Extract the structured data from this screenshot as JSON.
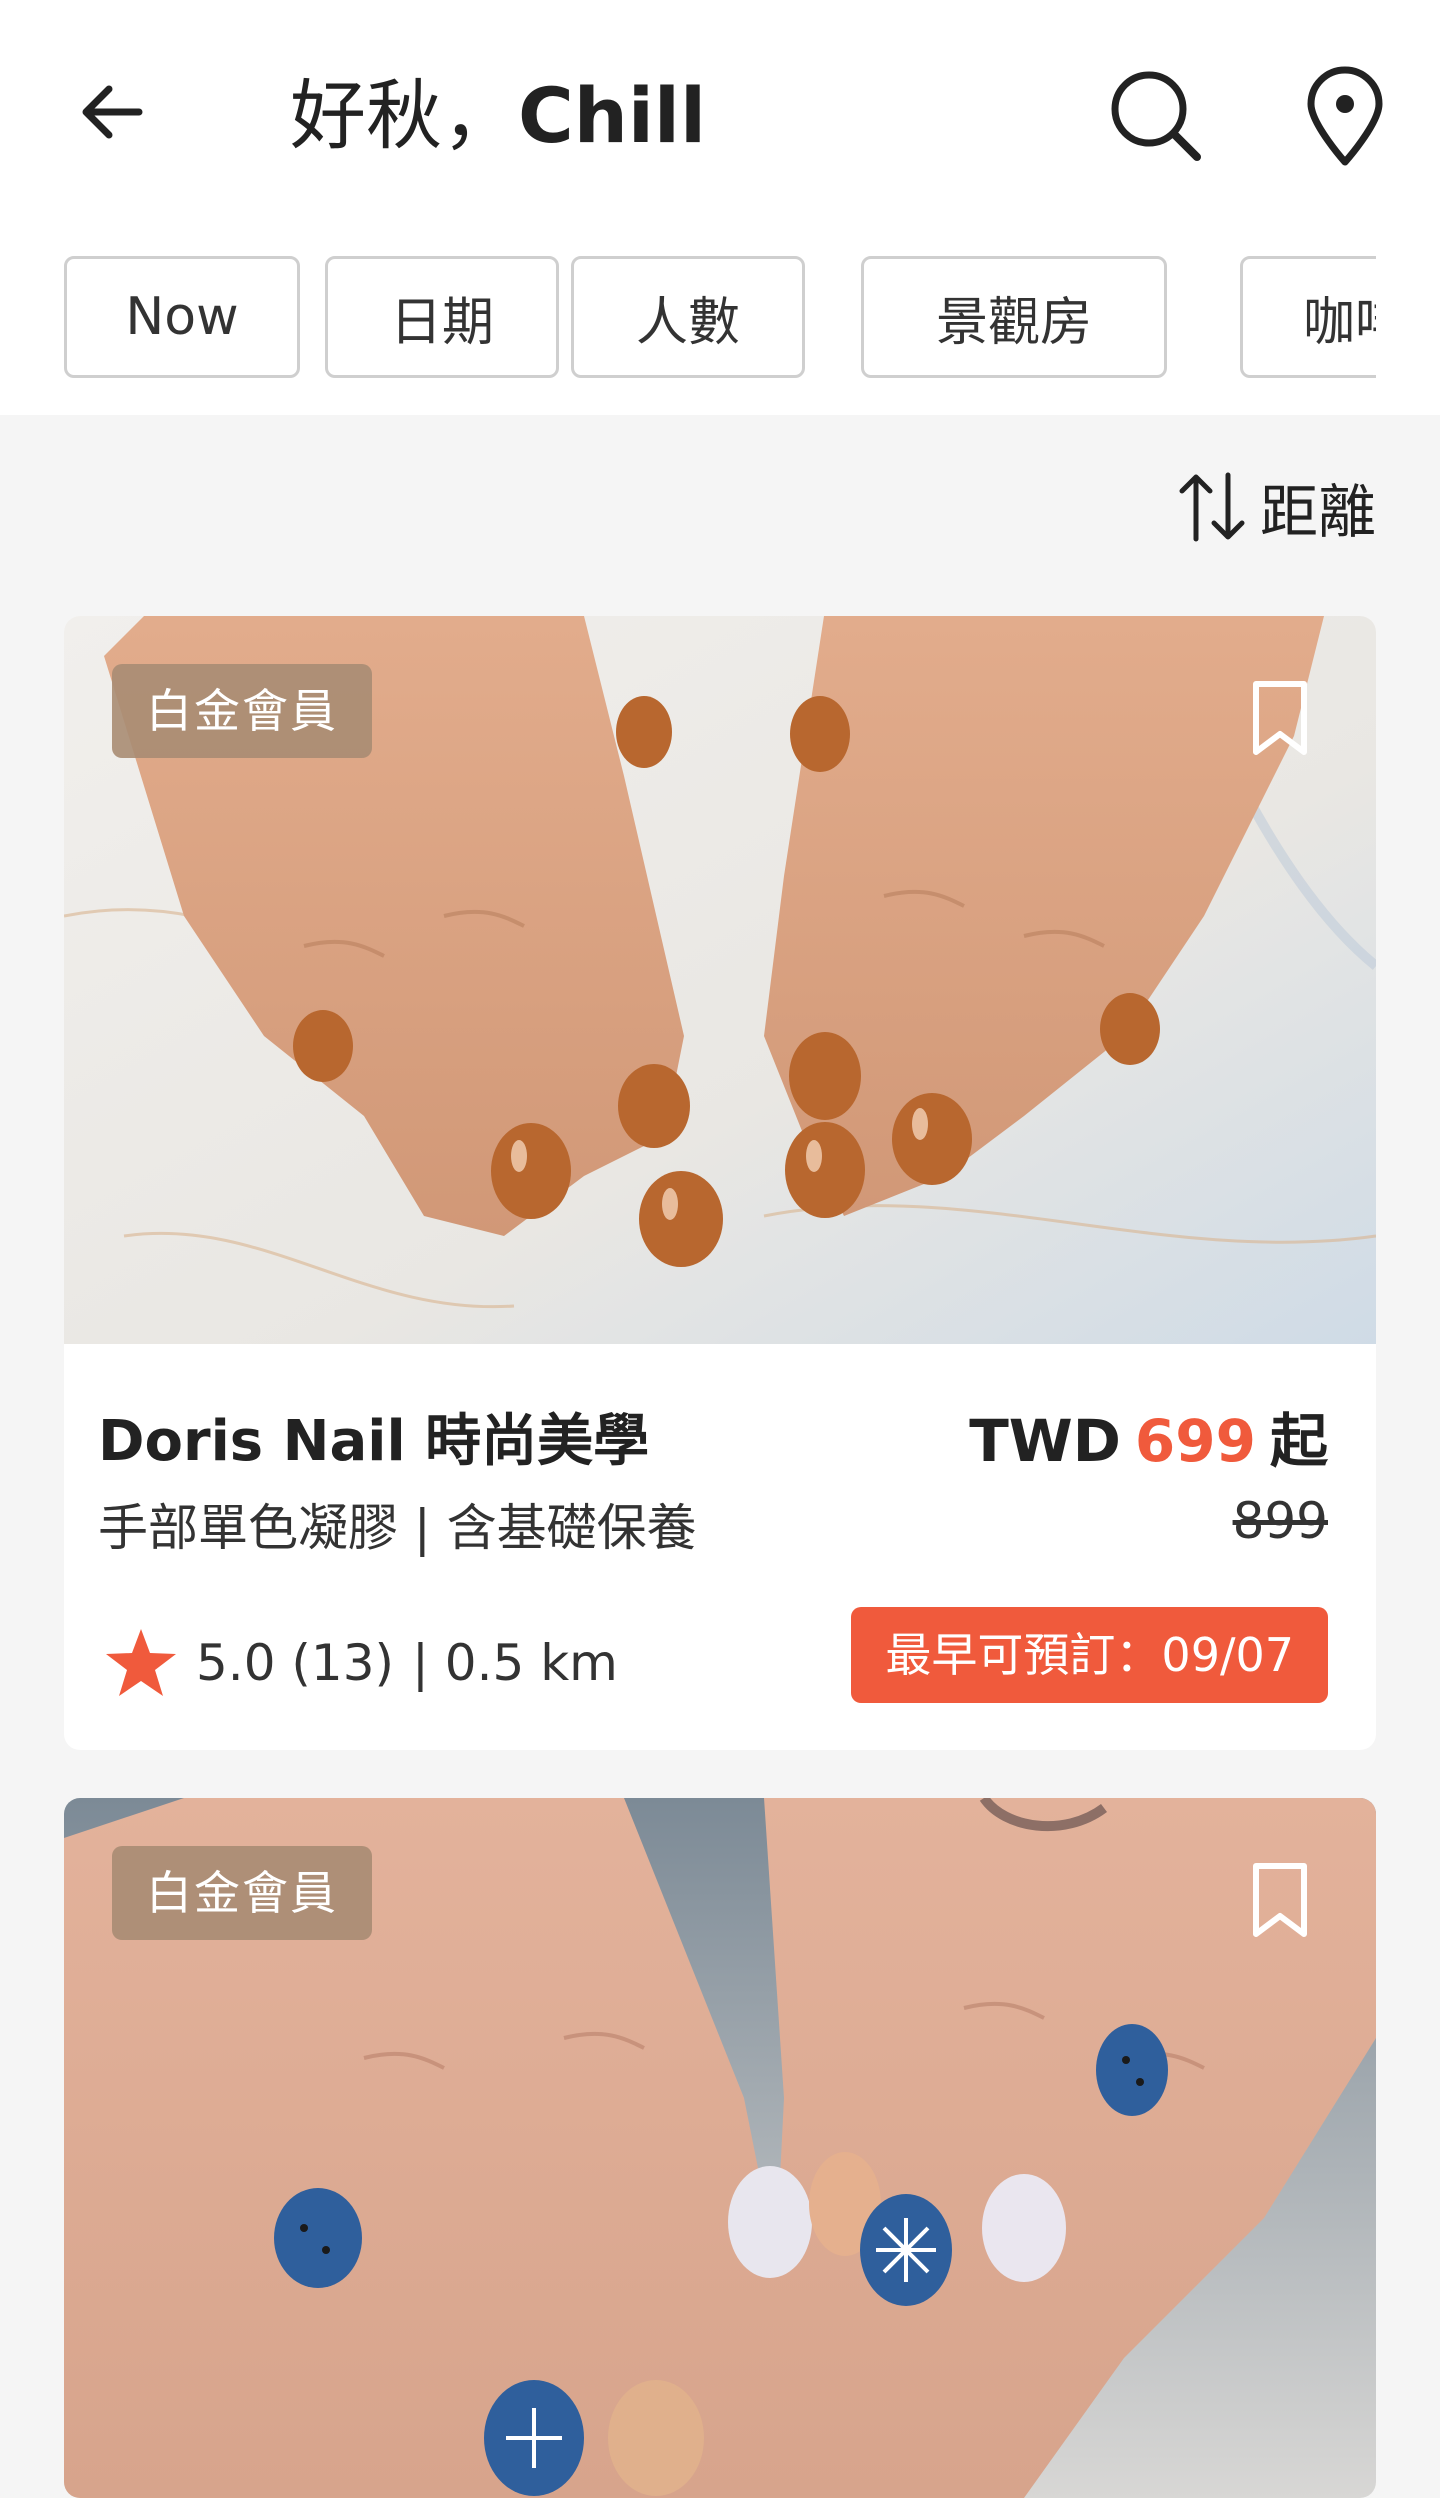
{
  "header": {
    "title_zh": "好秋，",
    "title_en": "Chill",
    "back_icon": "arrow-left-icon",
    "search_icon": "search-icon",
    "location_icon": "map-pin-icon"
  },
  "filters": [
    "Now",
    "日期",
    "人數",
    "景觀房",
    "咖啡"
  ],
  "sort": {
    "label": "距離",
    "icon": "sort-arrows-icon"
  },
  "colors": {
    "accent": "#f05a3c",
    "badge": "#a88c73"
  },
  "listings": [
    {
      "badge": "白金會員",
      "image": "brown-gel-nails-photo",
      "name": "Doris Nail 時尚美學",
      "service": "手部單色凝膠 | 含基礎保養",
      "currency": "TWD",
      "price": "699",
      "price_suffix": "起",
      "original_price": "899",
      "rating": "5.0 (13)",
      "distance": "| 0.5 km",
      "booking": "最早可預訂：09/07"
    },
    {
      "badge": "白金會員",
      "image": "blue-floral-nails-photo"
    }
  ]
}
